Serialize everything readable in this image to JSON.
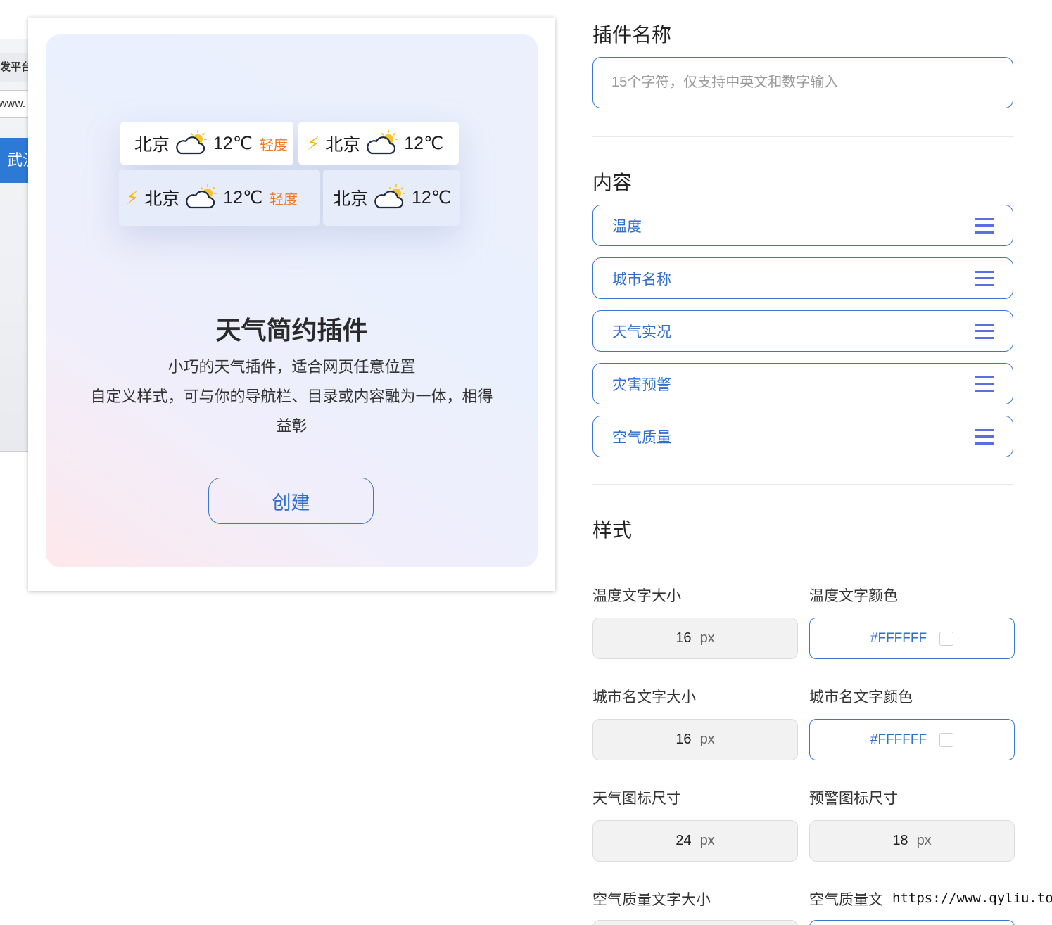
{
  "background_window": {
    "tab_text": "发平台",
    "url_text": "www.",
    "blue_text": "武汉"
  },
  "preview": {
    "chips": [
      {
        "bolt": "",
        "city": "北京",
        "temp": "12℃",
        "warn": "轻度"
      },
      {
        "bolt": "⚡",
        "city": "北京",
        "temp": "12℃",
        "warn": ""
      },
      {
        "bolt": "⚡",
        "city": "北京",
        "temp": "12℃",
        "warn": "轻度"
      },
      {
        "bolt": "",
        "city": "北京",
        "temp": "12℃",
        "warn": ""
      }
    ],
    "title": "天气简约插件",
    "desc_line1": "小巧的天气插件，适合网页任意位置",
    "desc_line2": "自定义样式，可与你的导航栏、目录或内容融为一体，相得益彰",
    "create_label": "创建"
  },
  "panel": {
    "name_section": "插件名称",
    "name_placeholder": "15个字符，仅支持中英文和数字输入",
    "content_section": "内容",
    "content_items": [
      "温度",
      "城市名称",
      "天气实况",
      "灾害预警",
      "空气质量"
    ],
    "style_section": "样式",
    "fields": {
      "temp_size_label": "温度文字大小",
      "temp_size_value": "16",
      "temp_color_label": "温度文字颜色",
      "temp_color_value": "#FFFFFF",
      "city_size_label": "城市名文字大小",
      "city_size_value": "16",
      "city_color_label": "城市名文字颜色",
      "city_color_value": "#FFFFFF",
      "weather_icon_label": "天气图标尺寸",
      "weather_icon_value": "24",
      "warn_icon_label": "预警图标尺寸",
      "warn_icon_value": "18",
      "aqi_size_label": "空气质量文字大小",
      "aqi_color_label": "空气质量文",
      "unit": "px"
    }
  },
  "watermark": "https://www.qyliu.top",
  "colors": {
    "accent": "#3a78d0",
    "accent_text": "#2f6fd0",
    "warn": "#ee7a22",
    "bolt": "#f5b400",
    "menu_icon": "#5c6ee0"
  }
}
